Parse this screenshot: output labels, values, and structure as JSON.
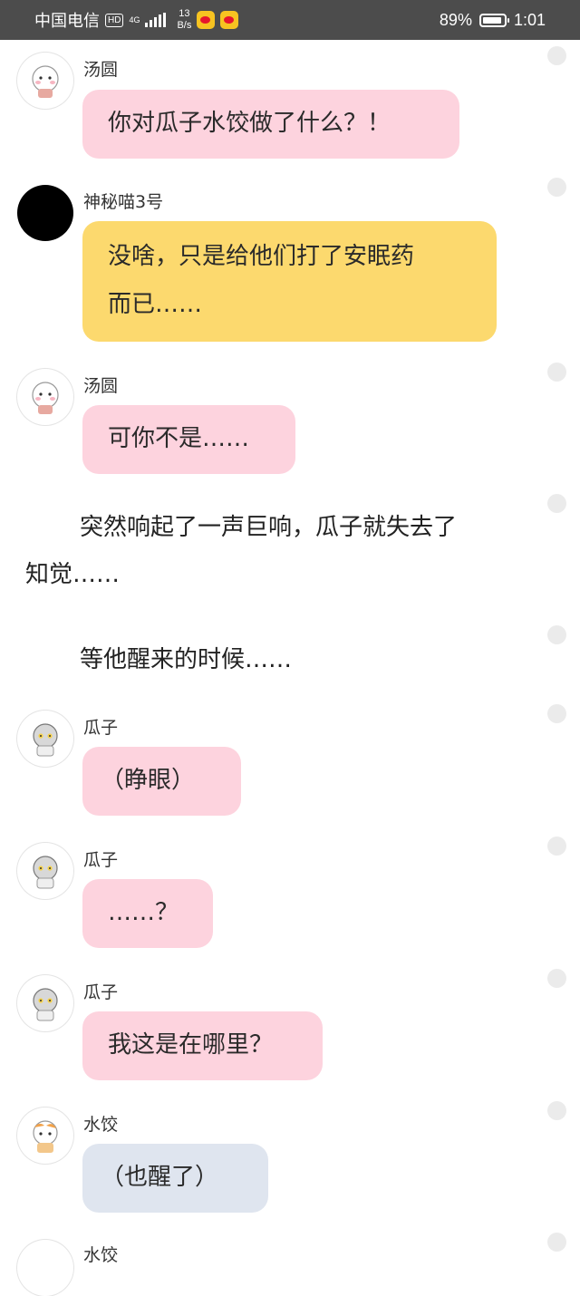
{
  "status_bar": {
    "carrier": "中国电信",
    "hd": "HD",
    "network": "4G",
    "speed_value": "13",
    "speed_unit": "B/s",
    "battery": "89%",
    "battery_level": 0.89,
    "time": "1:01"
  },
  "messages": [
    {
      "name": "汤圆",
      "text": "你对瓜子水饺做了什么？！"
    },
    {
      "name": "神秘喵3号",
      "text_line1": "没啥，只是给他们打了安眠药",
      "text_line2": "而已……"
    },
    {
      "name": "汤圆",
      "text": "可你不是……"
    },
    {
      "name": "瓜子",
      "text": "（睁眼）"
    },
    {
      "name": "瓜子",
      "text": "……？"
    },
    {
      "name": "瓜子",
      "text": "我这是在哪里？"
    },
    {
      "name": "水饺",
      "text": "（也醒了）"
    },
    {
      "name": "水饺"
    }
  ],
  "narration": {
    "line1": "突然响起了一声巨响，瓜子就失去了",
    "line2": "知觉……",
    "line3": "等他醒来的时候……"
  },
  "colors": {
    "tangyuan_bubble": "#fdd3de",
    "mystery_bubble": "#fcd96e",
    "shuijiao_bubble": "#dfe5ef",
    "status_bar": "#4c4c4c"
  }
}
